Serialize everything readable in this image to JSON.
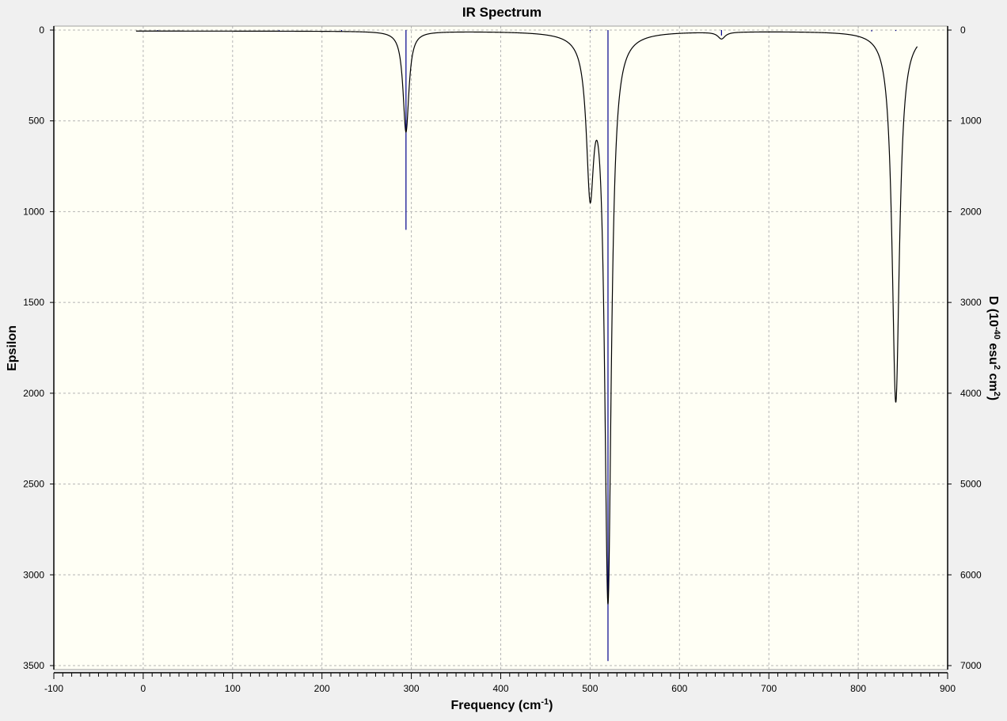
{
  "chart_data": {
    "type": "line",
    "title": "IR Spectrum",
    "xlabel": "Frequency (cm",
    "xlabel_sup": "-1",
    "xlabel_close": ")",
    "ylabel_left": "Epsilon",
    "ylabel_right_parts": [
      "D (10",
      "-40",
      " esu",
      "2",
      " cm",
      "2",
      ")"
    ],
    "xlim": [
      -100,
      900
    ],
    "ylim_left": [
      0,
      3500
    ],
    "ylim_right": [
      0,
      7000
    ],
    "y_inverted": true,
    "x_ticks": [
      -100,
      0,
      100,
      200,
      300,
      400,
      500,
      600,
      700,
      800,
      900
    ],
    "y_left_ticks": [
      0,
      500,
      1000,
      1500,
      2000,
      2500,
      3000,
      3500
    ],
    "y_right_ticks": [
      0,
      1000,
      2000,
      3000,
      4000,
      5000,
      6000,
      7000
    ],
    "grid": true,
    "x_range": [
      -8,
      866
    ],
    "series": [
      {
        "role": "spectrum",
        "color": "#000000",
        "peaks": [
          {
            "x": 294,
            "epsilon": 555,
            "hwhm": 4
          },
          {
            "x": 500,
            "epsilon": 795,
            "hwhm": 5
          },
          {
            "x": 520,
            "epsilon": 3110,
            "hwhm": 4.5
          },
          {
            "x": 647,
            "epsilon": 38,
            "hwhm": 5
          },
          {
            "x": 842,
            "epsilon": 2045,
            "hwhm": 5
          }
        ],
        "baseline_epsilon": 5
      },
      {
        "role": "intensity-sticks",
        "color": "#00008b",
        "sticks": [
          {
            "x": 16,
            "d": 10
          },
          {
            "x": 152,
            "d": 8
          },
          {
            "x": 222,
            "d": 15
          },
          {
            "x": 294,
            "d": 2200
          },
          {
            "x": 500,
            "d": 10
          },
          {
            "x": 520,
            "d": 6950
          },
          {
            "x": 647,
            "d": 60
          },
          {
            "x": 815,
            "d": 15
          },
          {
            "x": 842,
            "d": 10
          }
        ]
      }
    ],
    "colors": {
      "plot_bg": "#fffff5",
      "page_bg": "#f0f0f0",
      "grid": "#b4b4b4",
      "axis": "#000000"
    }
  }
}
